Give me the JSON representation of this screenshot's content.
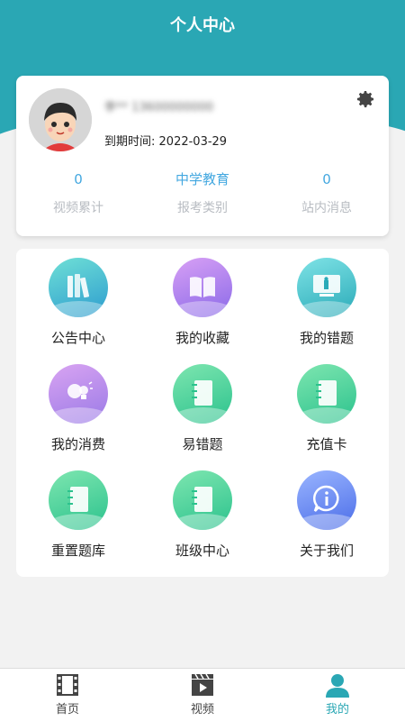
{
  "header": {
    "title": "个人中心"
  },
  "profile": {
    "name_masked": "李**  13600000000",
    "expire_label": "到期时间:",
    "expire_date": "2022-03-29",
    "stats": [
      {
        "value": "0",
        "label": "视频累计"
      },
      {
        "value": "中学教育",
        "label": "报考类别"
      },
      {
        "value": "0",
        "label": "站内消息"
      }
    ]
  },
  "menu": [
    {
      "label": "公告中心",
      "icon": "books-icon",
      "color": "teal"
    },
    {
      "label": "我的收藏",
      "icon": "open-book-icon",
      "color": "purple"
    },
    {
      "label": "我的错题",
      "icon": "blackboard-icon",
      "color": "cyan"
    },
    {
      "label": "我的消费",
      "icon": "bulb-icon",
      "color": "lavender"
    },
    {
      "label": "易错题",
      "icon": "notebook-icon",
      "color": "green"
    },
    {
      "label": "充值卡",
      "icon": "notebook-icon",
      "color": "green"
    },
    {
      "label": "重置题库",
      "icon": "notebook-icon",
      "color": "green"
    },
    {
      "label": "班级中心",
      "icon": "notebook-icon",
      "color": "green"
    },
    {
      "label": "关于我们",
      "icon": "info-icon",
      "color": "blue"
    }
  ],
  "tabbar": [
    {
      "label": "首页",
      "icon": "film-strip-icon"
    },
    {
      "label": "视频",
      "icon": "clapperboard-icon"
    },
    {
      "label": "我的",
      "icon": "user-icon",
      "active": true
    }
  ],
  "colors": {
    "accent": "#2aa7b4",
    "stat_value": "#44a8e0"
  }
}
